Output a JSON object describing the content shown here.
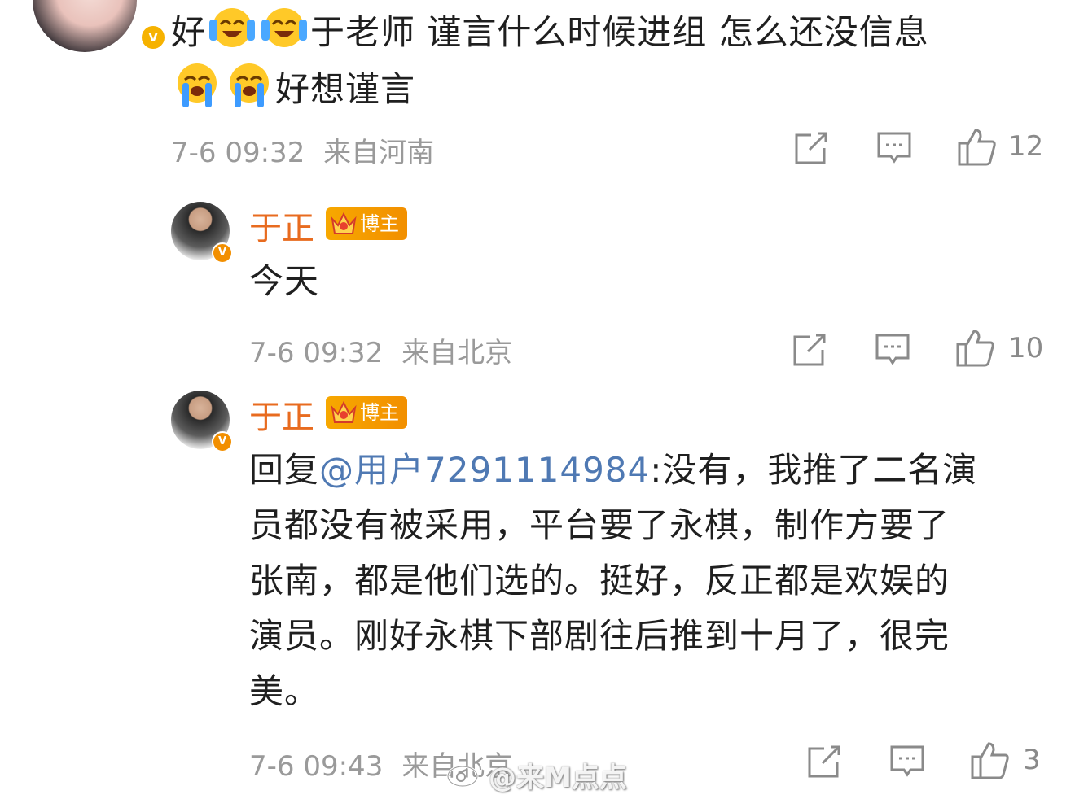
{
  "comment": {
    "text_line1_pre": "好",
    "text_line1_post": "于老师 谨言什么时候进组 怎么还没信息",
    "text_line2_post": "好想谨言",
    "time": "7-6 09:32",
    "location": "来自河南",
    "likes": "12"
  },
  "replies": [
    {
      "username": "于正",
      "badge": "博主",
      "text": "今天",
      "time": "7-6 09:32",
      "location": "来自北京",
      "likes": "10"
    },
    {
      "username": "于正",
      "badge": "博主",
      "reply_prefix": "回复",
      "mention": "@用户7291114984",
      "text_lines": [
        ":没有，我推了二名演",
        "员都没有被采用，平台要了永棋，制作方要了",
        "张南，都是他们选的。挺好，反正都是欢娱的",
        "演员。刚好永棋下部剧往后推到十月了，很完",
        "美。"
      ],
      "time": "7-6 09:43",
      "location": "来自北京",
      "likes": "3"
    }
  ],
  "watermark": "@来M点点",
  "icons": [
    "forward-icon",
    "comment-icon",
    "like-icon",
    "verified-icon",
    "crown-icon",
    "laughing-cry-emoji",
    "crying-emoji",
    "weibo-logo-icon"
  ],
  "colors": {
    "username": "#e86b1f",
    "mention": "#4f79b3",
    "badge": "#f7a800",
    "meta": "#9a9a9a"
  }
}
